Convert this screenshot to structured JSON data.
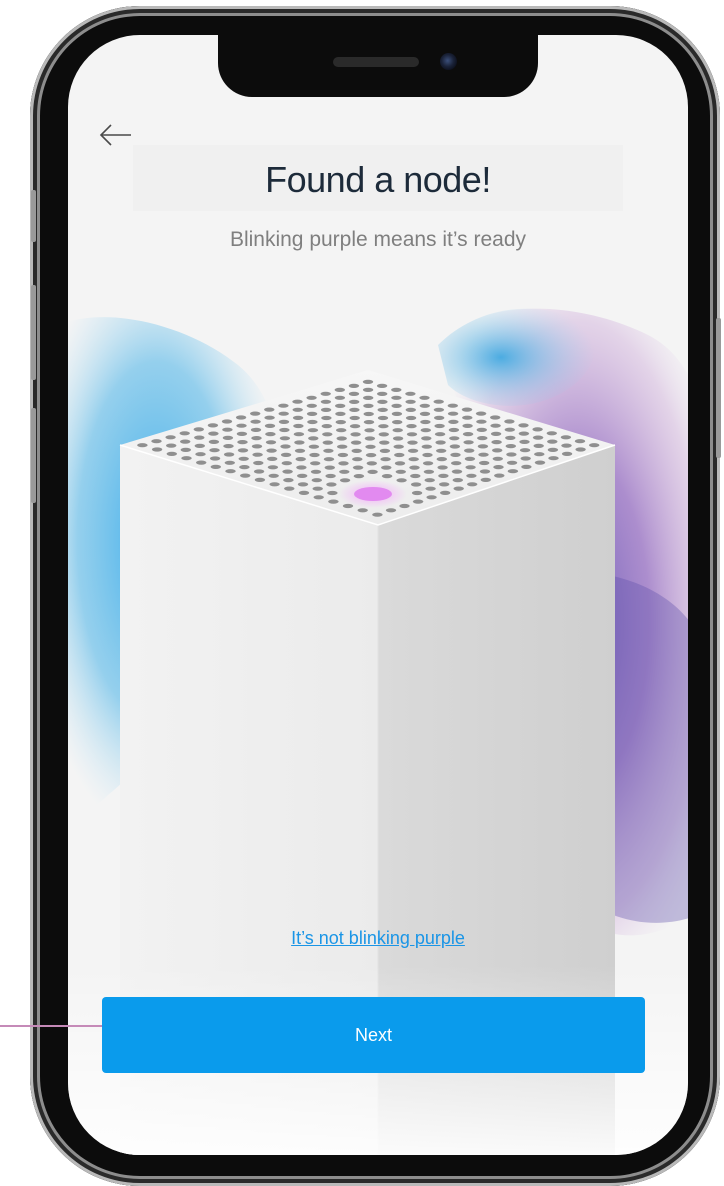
{
  "screen": {
    "title": "Found a node!",
    "subtitle": "Blinking purple means it’s ready",
    "help_link": "It’s not blinking purple",
    "next_label": "Next",
    "back_icon": "arrow-left-icon"
  },
  "colors": {
    "primary_button": "#0a9bec",
    "link": "#1a95e6",
    "title_text": "#1d2b3a",
    "subtitle_text": "#7f7f7f",
    "node_light": "#e28af0",
    "callout": "#c58ab8"
  },
  "device": {
    "status_light": "blinking purple"
  }
}
